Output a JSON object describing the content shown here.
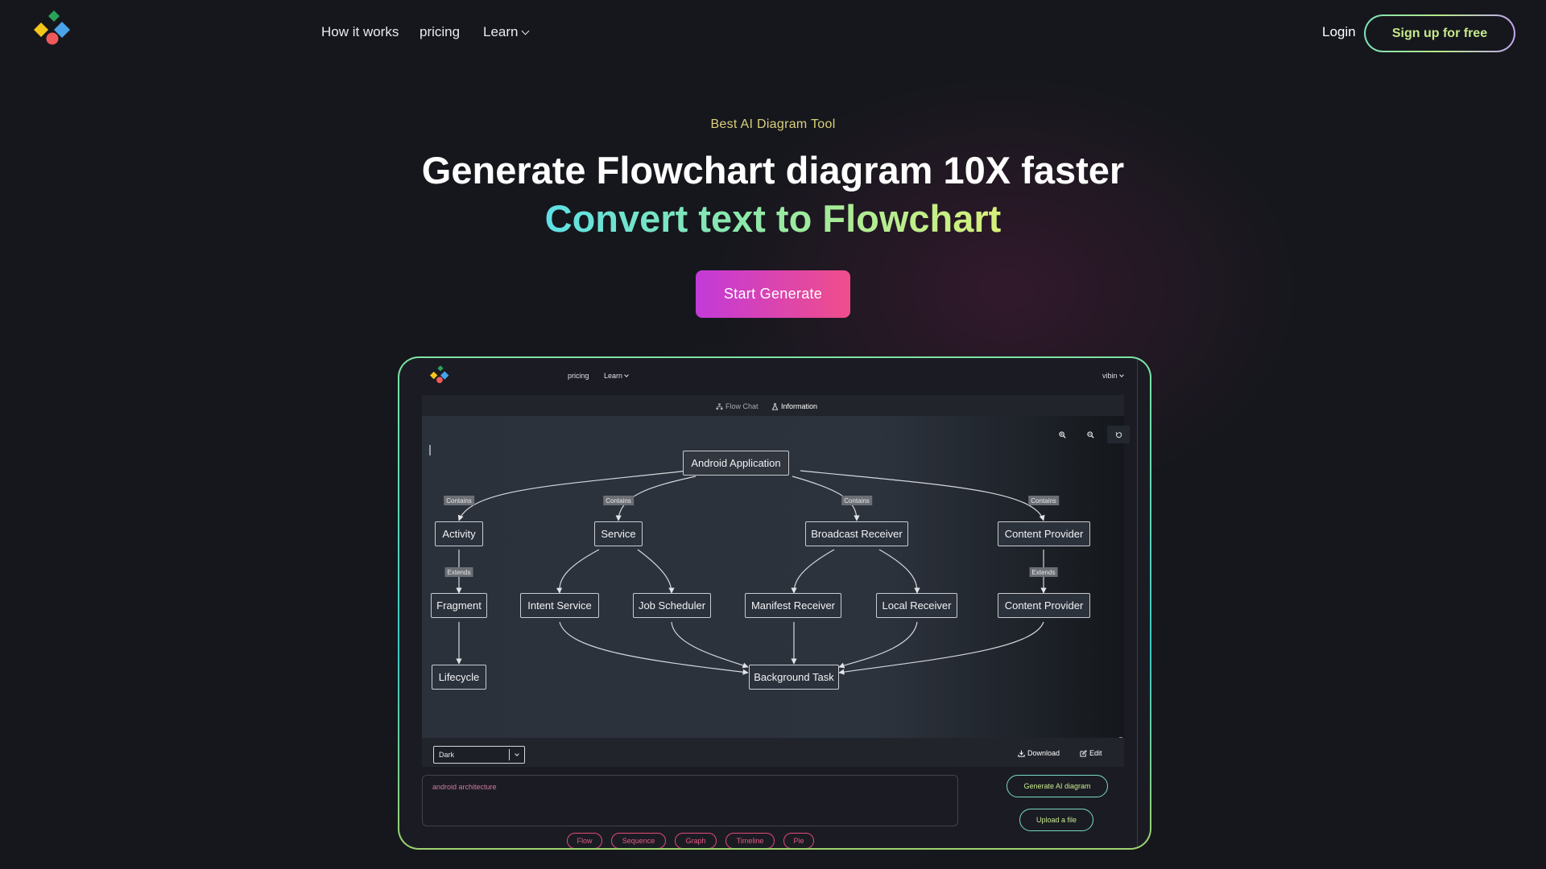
{
  "nav": {
    "logo_icon": "diamond-logo-icon",
    "links": [
      "How it works",
      "pricing",
      "Learn"
    ],
    "login": "Login",
    "signup": "Sign up for free"
  },
  "hero": {
    "eyebrow": "Best AI Diagram Tool",
    "headline": "Generate Flowchart diagram 10X faster",
    "subheadline": "Convert text to Flowchart",
    "cta": "Start Generate"
  },
  "preview": {
    "nav": {
      "pricing": "pricing",
      "learn": "Learn",
      "user": "vibin"
    },
    "tabs": [
      "Flow Chat",
      "Information"
    ],
    "zoom_icons": [
      "zoom-in-icon",
      "zoom-out-icon",
      "reset-icon"
    ],
    "diagram": {
      "nodes": {
        "root": "Android Application",
        "activity": "Activity",
        "service": "Service",
        "broadcast_receiver": "Broadcast Receiver",
        "content_provider": "Content Provider",
        "fragment": "Fragment",
        "intent_service": "Intent Service",
        "job_scheduler": "Job Scheduler",
        "manifest_receiver": "Manifest Receiver",
        "local_receiver": "Local Receiver",
        "content_provider_2": "Content Provider",
        "lifecycle": "Lifecycle",
        "background_task": "Background Task"
      },
      "edge_labels": {
        "contains_1": "Contains",
        "contains_2": "Contains",
        "contains_3": "Contains",
        "contains_4": "Contains",
        "extends_1": "Extends",
        "extends_2": "Extends"
      }
    },
    "theme_select": {
      "value": "Dark"
    },
    "actions": {
      "download": "Download",
      "edit": "Edit"
    },
    "prompt": {
      "value": "android architecture"
    },
    "buttons": {
      "generate": "Generate AI diagram",
      "upload": "Upload a file"
    },
    "chips": [
      "Flow",
      "Sequence",
      "Graph",
      "Timeline",
      "Pie"
    ]
  },
  "colors": {
    "background": "#16171d",
    "cta_start": "#c23ad8",
    "cta_end": "#f04e8a",
    "accent_green": "#c6e98a",
    "eyebrow": "#d9d07a",
    "chip_pink": "#e24a78"
  }
}
